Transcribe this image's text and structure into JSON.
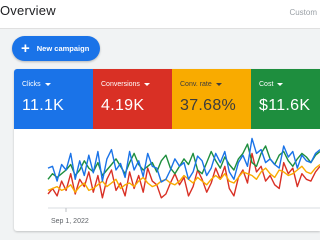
{
  "header": {
    "title": "Overview",
    "custom_label": "Custom"
  },
  "new_campaign": {
    "icon": "plus-icon",
    "label": "New campaign"
  },
  "metrics": [
    {
      "label": "Clicks",
      "value": "11.1K",
      "color": "#1a73e8",
      "text_color": "#ffffff"
    },
    {
      "label": "Conversions",
      "value": "4.19K",
      "color": "#d93025",
      "text_color": "#ffffff"
    },
    {
      "label": "Conv. rate",
      "value": "37.68%",
      "color": "#f9ab00",
      "text_color": "#3c3c3c"
    },
    {
      "label": "Cost",
      "value": "$11.6K",
      "color": "#1e8e3e",
      "text_color": "#ffffff"
    }
  ],
  "chart_data": {
    "type": "line",
    "x_start_label": "Sep 1, 2022",
    "series": [
      {
        "color": "#1a73e8",
        "values": [
          42,
          44,
          28,
          46,
          40,
          58,
          30,
          50,
          34,
          56,
          37,
          60,
          28,
          52,
          62,
          40,
          47,
          32,
          60,
          40,
          50,
          33,
          58,
          44,
          42,
          27,
          30,
          40,
          52,
          44,
          48,
          30,
          38,
          55,
          50,
          34,
          42,
          58,
          48,
          60,
          38,
          30,
          48,
          56,
          44,
          74,
          58,
          62,
          48,
          52,
          46,
          42,
          66,
          54,
          60,
          42,
          56,
          50,
          48,
          58,
          62
        ]
      },
      {
        "color": "#1e8e3e",
        "values": [
          30,
          36,
          32,
          36,
          40,
          46,
          34,
          40,
          50,
          42,
          38,
          48,
          34,
          40,
          46,
          52,
          44,
          36,
          48,
          58,
          46,
          40,
          44,
          48,
          38,
          50,
          56,
          42,
          36,
          44,
          52,
          46,
          58,
          40,
          36,
          48,
          60,
          50,
          42,
          54,
          46,
          40,
          52,
          58,
          68,
          48,
          44,
          58,
          66,
          52,
          46,
          56,
          60,
          50,
          44,
          52,
          58,
          54,
          48,
          56,
          60
        ]
      },
      {
        "color": "#f9ab00",
        "values": [
          18,
          20,
          22,
          18,
          20,
          24,
          16,
          22,
          26,
          18,
          20,
          24,
          28,
          22,
          26,
          30,
          20,
          24,
          26,
          22,
          28,
          32,
          26,
          22,
          24,
          28,
          30,
          26,
          24,
          28,
          34,
          30,
          26,
          32,
          28,
          24,
          30,
          34,
          30,
          36,
          28,
          26,
          32,
          38,
          36,
          34,
          30,
          38,
          42,
          36,
          32,
          40,
          38,
          34,
          36,
          40,
          44,
          38,
          36,
          42,
          46
        ]
      },
      {
        "color": "#d93025",
        "values": [
          14,
          20,
          12,
          28,
          18,
          36,
          14,
          30,
          22,
          38,
          16,
          34,
          10,
          30,
          40,
          18,
          26,
          12,
          38,
          20,
          34,
          16,
          42,
          28,
          24,
          10,
          14,
          26,
          36,
          24,
          32,
          12,
          22,
          40,
          30,
          16,
          26,
          42,
          30,
          44,
          20,
          12,
          32,
          40,
          26,
          58,
          38,
          44,
          28,
          34,
          24,
          20,
          48,
          36,
          42,
          22,
          36,
          30,
          28,
          38,
          44
        ]
      }
    ]
  }
}
